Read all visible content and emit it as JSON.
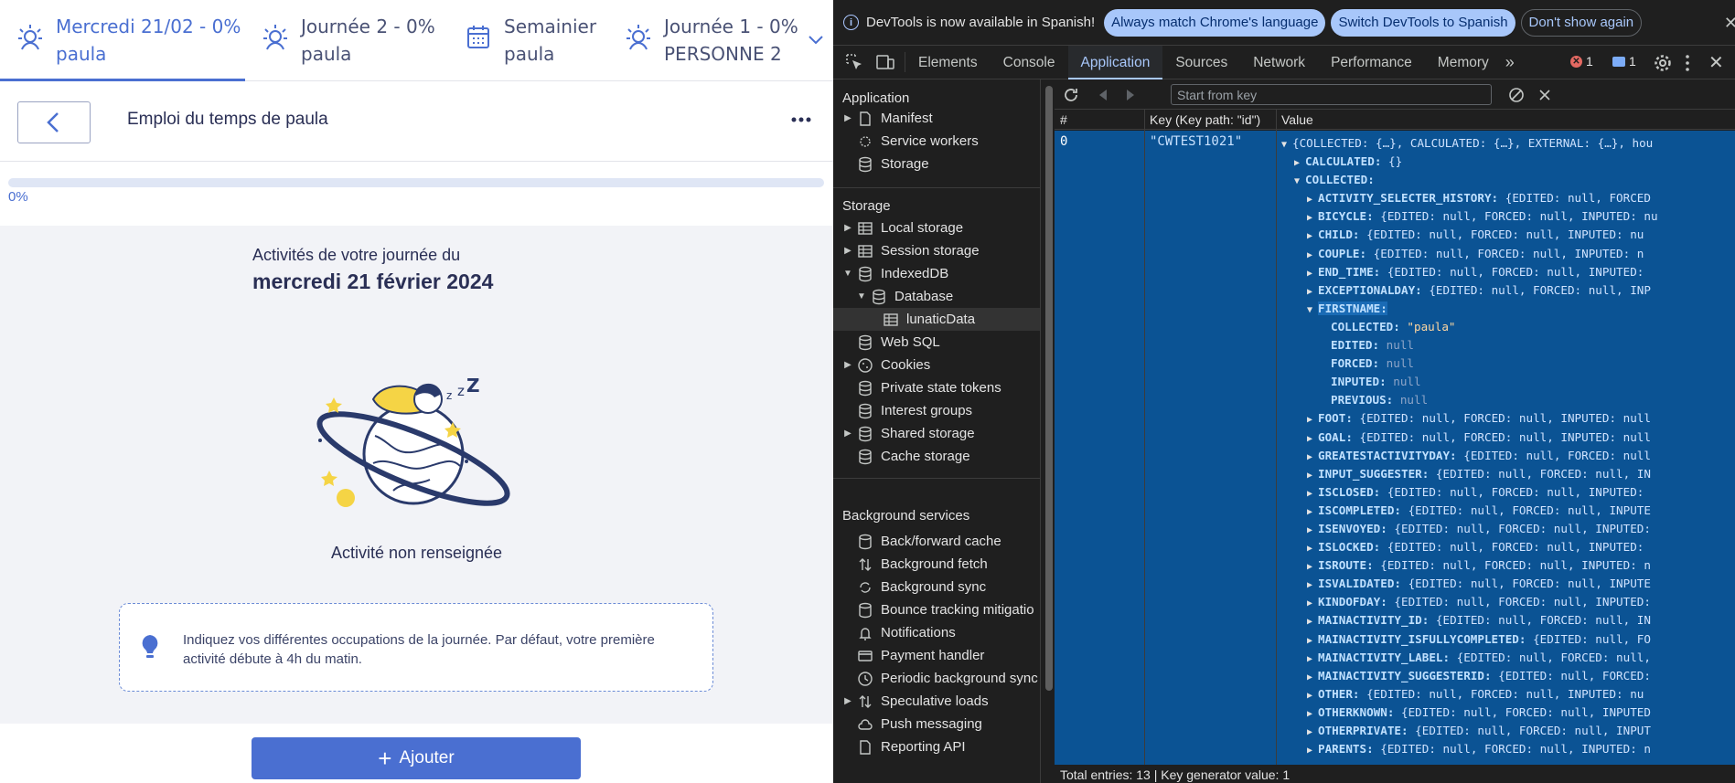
{
  "app": {
    "tabs": [
      {
        "line1": "Mercredi 21/02 - 0%",
        "line2": "paula",
        "icon": "sun-person-icon",
        "active": true
      },
      {
        "line1": "Journée 2 - 0%",
        "line2": "paula",
        "icon": "sun-person-icon",
        "active": false
      },
      {
        "line1": "Semainier",
        "line2": "paula",
        "icon": "calendar-icon",
        "active": false
      },
      {
        "line1": "Journée 1 - 0%",
        "line2": "PERSONNE 2",
        "icon": "sun-person-icon",
        "active": false
      }
    ],
    "page_title": "Emploi du temps de paula",
    "progress": {
      "value": 0,
      "label": "0%"
    },
    "day": {
      "intro": "Activités de votre journée du",
      "date": "mercredi 21 février 2024",
      "empty_label": "Activité non renseignée"
    },
    "hint": {
      "text": "Indiquez vos différentes occupations de la journée. Par défaut, votre première activité débute à 4h du matin."
    },
    "add_button": "Ajouter",
    "colors": {
      "accent": "#4a6fd1",
      "text": "#2a2f55"
    }
  },
  "devtools": {
    "infobar": {
      "text": "DevTools is now available in Spanish!",
      "btn_match": "Always match Chrome's language",
      "btn_switch": "Switch DevTools to Spanish",
      "btn_dismiss": "Don't show again"
    },
    "tabs": [
      "Elements",
      "Console",
      "Application",
      "Sources",
      "Network",
      "Performance",
      "Memory"
    ],
    "active_tab": "Application",
    "badges": {
      "errors": "1",
      "messages": "1"
    },
    "sidebar": {
      "application_title": "Application",
      "application_items": [
        "Manifest",
        "Service workers",
        "Storage"
      ],
      "storage_title": "Storage",
      "storage_items": [
        "Local storage",
        "Session storage",
        "IndexedDB",
        "Database",
        "lunaticData",
        "Web SQL",
        "Cookies",
        "Private state tokens",
        "Interest groups",
        "Shared storage",
        "Cache storage"
      ],
      "bg_title": "Background services",
      "bg_items": [
        "Back/forward cache",
        "Background fetch",
        "Background sync",
        "Bounce tracking mitigatio",
        "Notifications",
        "Payment handler",
        "Periodic background sync",
        "Speculative loads",
        "Push messaging",
        "Reporting API"
      ]
    },
    "key_placeholder": "Start from key",
    "table": {
      "col_index": "#",
      "col_key": "Key (Key path: \"id\")",
      "col_value": "Value",
      "row_index": "0",
      "row_key": "\"CWTEST1021\""
    },
    "tree": {
      "root": "{COLLECTED: {…}, CALCULATED: {…}, EXTERNAL: {…}, hou",
      "calculated_key": "CALCULATED:",
      "calculated_val": "{}",
      "collected_key": "COLLECTED:",
      "items": [
        {
          "key": "ACTIVITY_SELECTER_HISTORY:",
          "val": "{EDITED: null, FORCED"
        },
        {
          "key": "BICYCLE:",
          "val": "{EDITED: null, FORCED: null, INPUTED: nu"
        },
        {
          "key": "CHILD:",
          "val": "{EDITED: null, FORCED: null, INPUTED: nu"
        },
        {
          "key": "COUPLE:",
          "val": "{EDITED: null, FORCED: null, INPUTED: n"
        },
        {
          "key": "END_TIME:",
          "val": "{EDITED: null, FORCED: null, INPUTED:"
        },
        {
          "key": "EXCEPTIONALDAY:",
          "val": "{EDITED: null, FORCED: null, INP"
        }
      ],
      "firstname_key": "FIRSTNAME:",
      "firstname_children": [
        {
          "key": "COLLECTED:",
          "val": "\"paula\"",
          "type": "s"
        },
        {
          "key": "EDITED:",
          "val": "null",
          "type": "n"
        },
        {
          "key": "FORCED:",
          "val": "null",
          "type": "n"
        },
        {
          "key": "INPUTED:",
          "val": "null",
          "type": "n"
        },
        {
          "key": "PREVIOUS:",
          "val": "null",
          "type": "n"
        }
      ],
      "items_after": [
        {
          "key": "FOOT:",
          "val": "{EDITED: null, FORCED: null, INPUTED: null"
        },
        {
          "key": "GOAL:",
          "val": "{EDITED: null, FORCED: null, INPUTED: null"
        },
        {
          "key": "GREATESTACTIVITYDAY:",
          "val": "{EDITED: null, FORCED: null"
        },
        {
          "key": "INPUT_SUGGESTER:",
          "val": "{EDITED: null, FORCED: null, IN"
        },
        {
          "key": "ISCLOSED:",
          "val": "{EDITED: null, FORCED: null, INPUTED: "
        },
        {
          "key": "ISCOMPLETED:",
          "val": "{EDITED: null, FORCED: null, INPUTE"
        },
        {
          "key": "ISENVOYED:",
          "val": "{EDITED: null, FORCED: null, INPUTED:"
        },
        {
          "key": "ISLOCKED:",
          "val": "{EDITED: null, FORCED: null, INPUTED: "
        },
        {
          "key": "ISROUTE:",
          "val": "{EDITED: null, FORCED: null, INPUTED: n"
        },
        {
          "key": "ISVALIDATED:",
          "val": "{EDITED: null, FORCED: null, INPUTE"
        },
        {
          "key": "KINDOFDAY:",
          "val": "{EDITED: null, FORCED: null, INPUTED: "
        },
        {
          "key": "MAINACTIVITY_ID:",
          "val": "{EDITED: null, FORCED: null, IN"
        },
        {
          "key": "MAINACTIVITY_ISFULLYCOMPLETED:",
          "val": "{EDITED: null, FO"
        },
        {
          "key": "MAINACTIVITY_LABEL:",
          "val": "{EDITED: null, FORCED: null,"
        },
        {
          "key": "MAINACTIVITY_SUGGESTERID:",
          "val": "{EDITED: null, FORCED:"
        },
        {
          "key": "OTHER:",
          "val": "{EDITED: null, FORCED: null, INPUTED: nu"
        },
        {
          "key": "OTHERKNOWN:",
          "val": "{EDITED: null, FORCED: null, INPUTED"
        },
        {
          "key": "OTHERPRIVATE:",
          "val": "{EDITED: null, FORCED: null, INPUT"
        },
        {
          "key": "PARENTS:",
          "val": "{EDITED: null, FORCED: null, INPUTED: n"
        }
      ]
    },
    "footer": "Total entries: 13 | Key generator value: 1",
    "colors": {
      "selected_row": "#0b5394",
      "accent": "#a8c7fa"
    }
  }
}
